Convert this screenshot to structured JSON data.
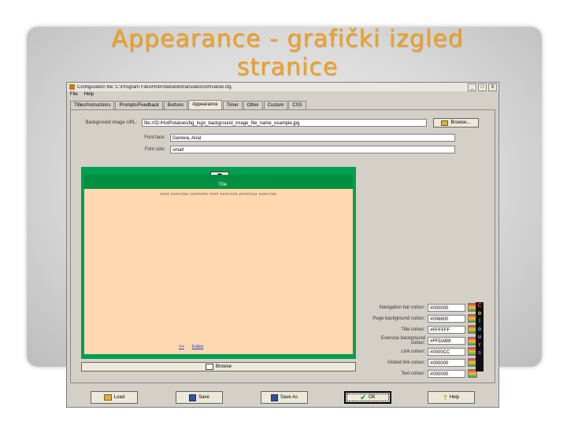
{
  "slide": {
    "title_line1": "Appearance - grafički izgled",
    "title_line2": "stranice"
  },
  "window": {
    "title": "Configuration file: C:\\Program Files\\HotPotatoes6\\translations\\hrvatski.cfg",
    "buttons": [
      "_",
      "□",
      "X"
    ],
    "menu": [
      "File",
      "Help"
    ]
  },
  "tabs": [
    "Titles/Instructions",
    "Prompts/Feedback",
    "Buttons",
    "Appearance",
    "Timer",
    "Other",
    "Custom",
    "CSS"
  ],
  "active_tab": "Appearance",
  "form": {
    "bg_image_label": "Background image URL:",
    "bg_image_value": "file:///D:/HotPotatoes/bg_logo_background_image_file_name_example.jpg",
    "browse_label": "Browse...",
    "font_face_label": "Font face:",
    "font_face_value": "Geneva, Arial",
    "font_size_label": "Font size:",
    "font_size_value": "small"
  },
  "preview": {
    "tab_mark": "▬",
    "header_label": "Title",
    "links": "next exercise   contents   next exercise   previous exercise",
    "nav_items": [
      "<=",
      "Index"
    ],
    "browse_button": "Browse"
  },
  "colours": {
    "rows": [
      {
        "label": "Navigation bar colour:",
        "value": "#000000"
      },
      {
        "label": "Page background colour:",
        "value": "#006600"
      },
      {
        "label": "Title colour:",
        "value": "#FFFFFF"
      },
      {
        "label": "Exercise background colour:",
        "value": "#FFDAB9"
      },
      {
        "label": "Link colour:",
        "value": "#0000CC"
      },
      {
        "label": "Visited link colour:",
        "value": "#000000"
      },
      {
        "label": "Text colour:",
        "value": "#000000"
      }
    ],
    "word": [
      "C",
      "o",
      "l",
      "o",
      "u",
      "r",
      "s"
    ],
    "word_colors": [
      "#ff4040",
      "#ffe040",
      "#40c040",
      "#40c0ff",
      "#c080ff",
      "#ff8040",
      "#ff40ff"
    ]
  },
  "bottom_buttons": [
    "Load",
    "Save",
    "Save As",
    "OK",
    "Help"
  ],
  "colors": {
    "title_orange": "#f0a020",
    "preview_green": "#00a050",
    "preview_body": "#ffd8b0"
  }
}
